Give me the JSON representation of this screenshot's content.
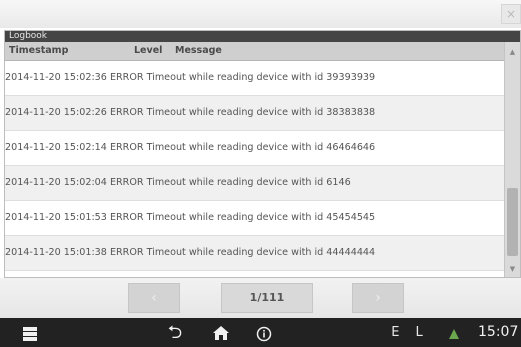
{
  "window": {
    "title": "Logbook",
    "close_label": "×"
  },
  "table": {
    "columns": {
      "timestamp": "Timestamp",
      "level": "Level",
      "message": "Message"
    },
    "rows": [
      {
        "text": "2014-11-20 15:02:36 ERROR Timeout while reading device with id 39393939"
      },
      {
        "text": "2014-11-20 15:02:26 ERROR Timeout while reading device with id 38383838"
      },
      {
        "text": "2014-11-20 15:02:14 ERROR Timeout while reading device with id 46464646"
      },
      {
        "text": "2014-11-20 15:02:04 ERROR Timeout while reading device with id 6146"
      },
      {
        "text": "2014-11-20 15:01:53 ERROR Timeout while reading device with id 45454545"
      },
      {
        "text": "2014-11-20 15:01:38 ERROR Timeout while reading device with id 44444444"
      }
    ]
  },
  "scrollbar": {
    "up_glyph": "▲",
    "down_glyph": "▼"
  },
  "pager": {
    "prev_glyph": "‹",
    "next_glyph": "›",
    "indicator": "1/111"
  },
  "taskbar": {
    "back_glyph": "⮌",
    "home_glyph": "🏠",
    "language": "E L",
    "clock": "15:07"
  },
  "colors": {
    "titlebar": "#454545",
    "header": "#cfcfcf",
    "taskbar": "#222222",
    "warning": "#6aa84f"
  },
  "icons": [
    "close-icon",
    "scroll-up-icon",
    "scroll-down-icon",
    "menu-icon",
    "back-icon",
    "home-icon",
    "info-icon",
    "warning-icon"
  ]
}
